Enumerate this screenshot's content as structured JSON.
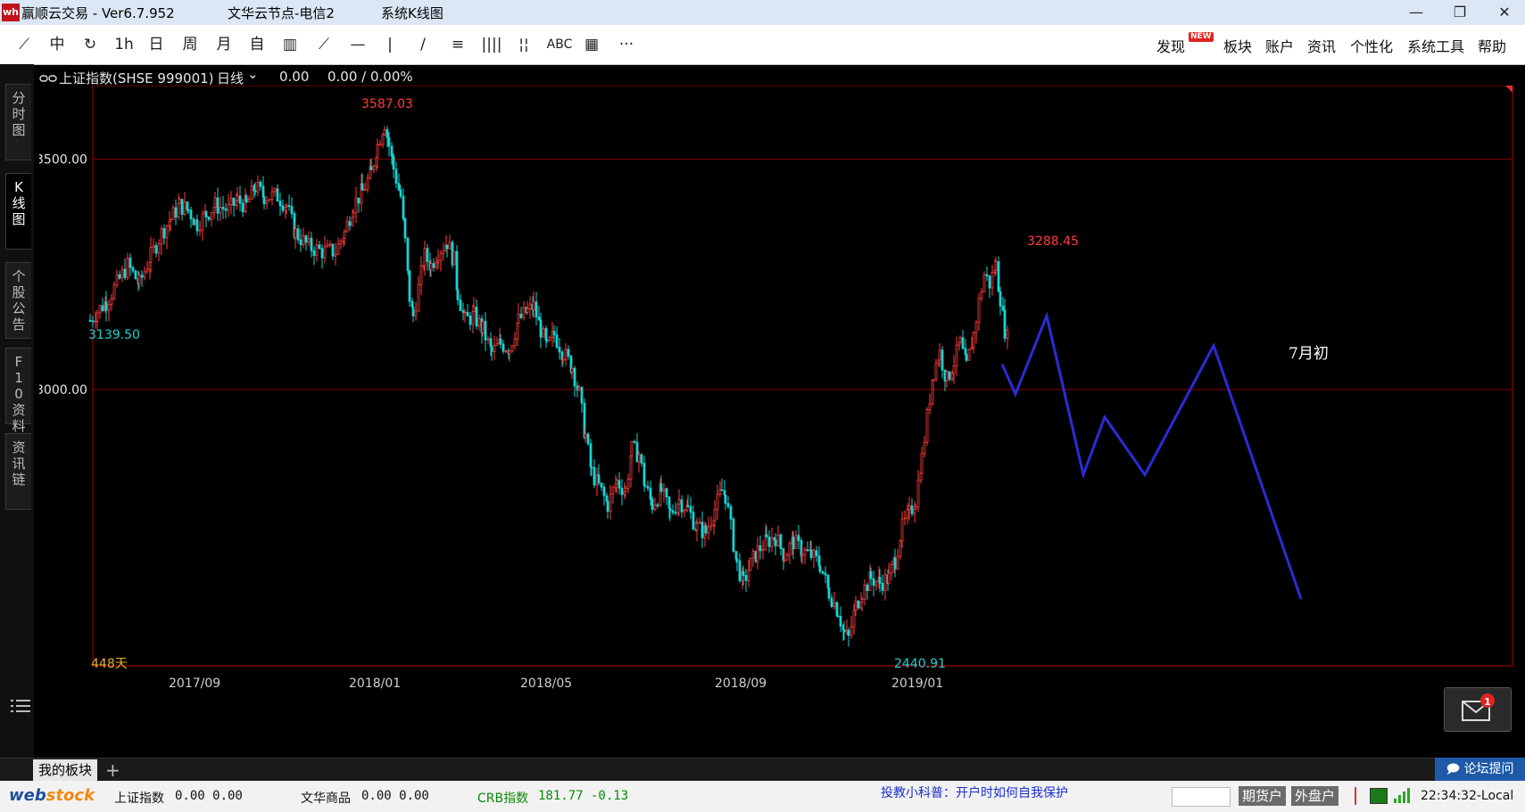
{
  "window": {
    "app_title": "赢顺云交易 - Ver6.7.952",
    "server": "文华云节点-电信2",
    "view": "系统K线图",
    "controls": {
      "minimize": "—",
      "restore": "❐",
      "close": "✕"
    }
  },
  "toolbar": {
    "tools": [
      "⟋",
      "中",
      "↻",
      "1h",
      "日",
      "周",
      "月",
      "自",
      "▥",
      "⟋",
      "—",
      "|",
      "∕",
      "≡",
      "||||",
      "¦¦",
      "ABC",
      "▦",
      "···"
    ],
    "menus": {
      "discover": "发现",
      "new_badge": "NEW",
      "sector": "板块",
      "account": "账户",
      "news": "资讯",
      "personalize": "个性化",
      "system_tools": "系统工具",
      "help": "帮助"
    }
  },
  "sidebar": {
    "tabs": [
      "分时图",
      "K线图",
      "个股公告",
      "F10资料",
      "资讯链"
    ],
    "active_index": 1
  },
  "chart_header": {
    "symbol": "上证指数(SHSE 999001)",
    "period": "日线",
    "change": "0.00",
    "change_pct": "0.00 / 0.00%"
  },
  "chart_data": {
    "type": "candlestick",
    "y_axis_labels": [
      "3500.00",
      "3000.00"
    ],
    "x_axis_labels": [
      "2017/09",
      "2018/01",
      "2018/05",
      "2018/09",
      "2019/01"
    ],
    "annotations": {
      "high": "3587.03",
      "low": "2440.91",
      "start_low": "3139.50",
      "recent_high": "3288.45",
      "days": "448天",
      "forecast_label": "7月初"
    },
    "ylim": [
      2400,
      3660
    ],
    "colors": {
      "up": "#ff3b3b",
      "down": "#19d2d2",
      "forecast": "#2b2bd8",
      "grid": "#8b0000"
    },
    "price_path": [
      [
        0,
        3150
      ],
      [
        8,
        3170
      ],
      [
        18,
        3190
      ],
      [
        30,
        3230
      ],
      [
        42,
        3270
      ],
      [
        55,
        3230
      ],
      [
        68,
        3290
      ],
      [
        80,
        3340
      ],
      [
        90,
        3370
      ],
      [
        100,
        3400
      ],
      [
        110,
        3390
      ],
      [
        120,
        3360
      ],
      [
        130,
        3380
      ],
      [
        140,
        3400
      ],
      [
        155,
        3390
      ],
      [
        165,
        3410
      ],
      [
        175,
        3400
      ],
      [
        185,
        3440
      ],
      [
        195,
        3420
      ],
      [
        210,
        3420
      ],
      [
        220,
        3400
      ],
      [
        230,
        3340
      ],
      [
        245,
        3310
      ],
      [
        260,
        3300
      ],
      [
        275,
        3300
      ],
      [
        285,
        3340
      ],
      [
        295,
        3400
      ],
      [
        305,
        3430
      ],
      [
        315,
        3470
      ],
      [
        322,
        3530
      ],
      [
        330,
        3580
      ],
      [
        335,
        3530
      ],
      [
        340,
        3480
      ],
      [
        348,
        3420
      ],
      [
        353,
        3320
      ],
      [
        358,
        3200
      ],
      [
        362,
        3160
      ],
      [
        368,
        3220
      ],
      [
        375,
        3290
      ],
      [
        382,
        3270
      ],
      [
        390,
        3300
      ],
      [
        400,
        3320
      ],
      [
        408,
        3280
      ],
      [
        412,
        3210
      ],
      [
        420,
        3150
      ],
      [
        430,
        3160
      ],
      [
        440,
        3130
      ],
      [
        450,
        3080
      ],
      [
        460,
        3100
      ],
      [
        470,
        3090
      ],
      [
        480,
        3150
      ],
      [
        490,
        3170
      ],
      [
        497,
        3180
      ],
      [
        505,
        3130
      ],
      [
        512,
        3090
      ],
      [
        520,
        3120
      ],
      [
        530,
        3080
      ],
      [
        540,
        3050
      ],
      [
        548,
        2990
      ],
      [
        555,
        2900
      ],
      [
        562,
        2820
      ],
      [
        570,
        2790
      ],
      [
        580,
        2750
      ],
      [
        590,
        2800
      ],
      [
        600,
        2780
      ],
      [
        607,
        2870
      ],
      [
        615,
        2860
      ],
      [
        622,
        2790
      ],
      [
        630,
        2750
      ],
      [
        640,
        2780
      ],
      [
        650,
        2730
      ],
      [
        660,
        2760
      ],
      [
        670,
        2740
      ],
      [
        680,
        2700
      ],
      [
        690,
        2690
      ],
      [
        700,
        2740
      ],
      [
        708,
        2780
      ],
      [
        712,
        2770
      ],
      [
        718,
        2700
      ],
      [
        725,
        2620
      ],
      [
        732,
        2580
      ],
      [
        740,
        2620
      ],
      [
        748,
        2650
      ],
      [
        758,
        2670
      ],
      [
        768,
        2680
      ],
      [
        778,
        2640
      ],
      [
        788,
        2670
      ],
      [
        798,
        2650
      ],
      [
        808,
        2640
      ],
      [
        818,
        2620
      ],
      [
        828,
        2560
      ],
      [
        838,
        2520
      ],
      [
        845,
        2470
      ],
      [
        850,
        2460
      ],
      [
        858,
        2530
      ],
      [
        865,
        2560
      ],
      [
        875,
        2590
      ],
      [
        885,
        2580
      ],
      [
        895,
        2590
      ],
      [
        902,
        2630
      ],
      [
        910,
        2700
      ],
      [
        918,
        2730
      ],
      [
        925,
        2760
      ],
      [
        932,
        2850
      ],
      [
        938,
        2940
      ],
      [
        945,
        3040
      ],
      [
        952,
        3080
      ],
      [
        960,
        3020
      ],
      [
        968,
        3060
      ],
      [
        975,
        3100
      ],
      [
        982,
        3050
      ],
      [
        990,
        3120
      ],
      [
        996,
        3190
      ],
      [
        1002,
        3250
      ],
      [
        1008,
        3230
      ],
      [
        1015,
        3270
      ],
      [
        1020,
        3200
      ],
      [
        1025,
        3130
      ],
      [
        1030,
        3100
      ]
    ],
    "forecast_path": [
      [
        1023,
        3055
      ],
      [
        1038,
        2990
      ],
      [
        1073,
        3160
      ],
      [
        1114,
        2815
      ],
      [
        1138,
        2940
      ],
      [
        1183,
        2815
      ],
      [
        1260,
        3095
      ],
      [
        1358,
        2545
      ]
    ]
  },
  "bottom": {
    "my_sector": "我的板块",
    "add": "+",
    "forum": "论坛提问",
    "status": {
      "idx1_name": "上证指数",
      "idx1_val": "0.00  0.00",
      "idx2_name": "文华商品",
      "idx2_val": "0.00  0.00",
      "idx3_name": "CRB指数",
      "idx3_val": "181.77  -0.13",
      "tip": "投教小科普：开户时如何自我保护",
      "futures_btn": "期货户",
      "foreign_btn": "外盘户",
      "time": "22:34:32-Local"
    }
  }
}
